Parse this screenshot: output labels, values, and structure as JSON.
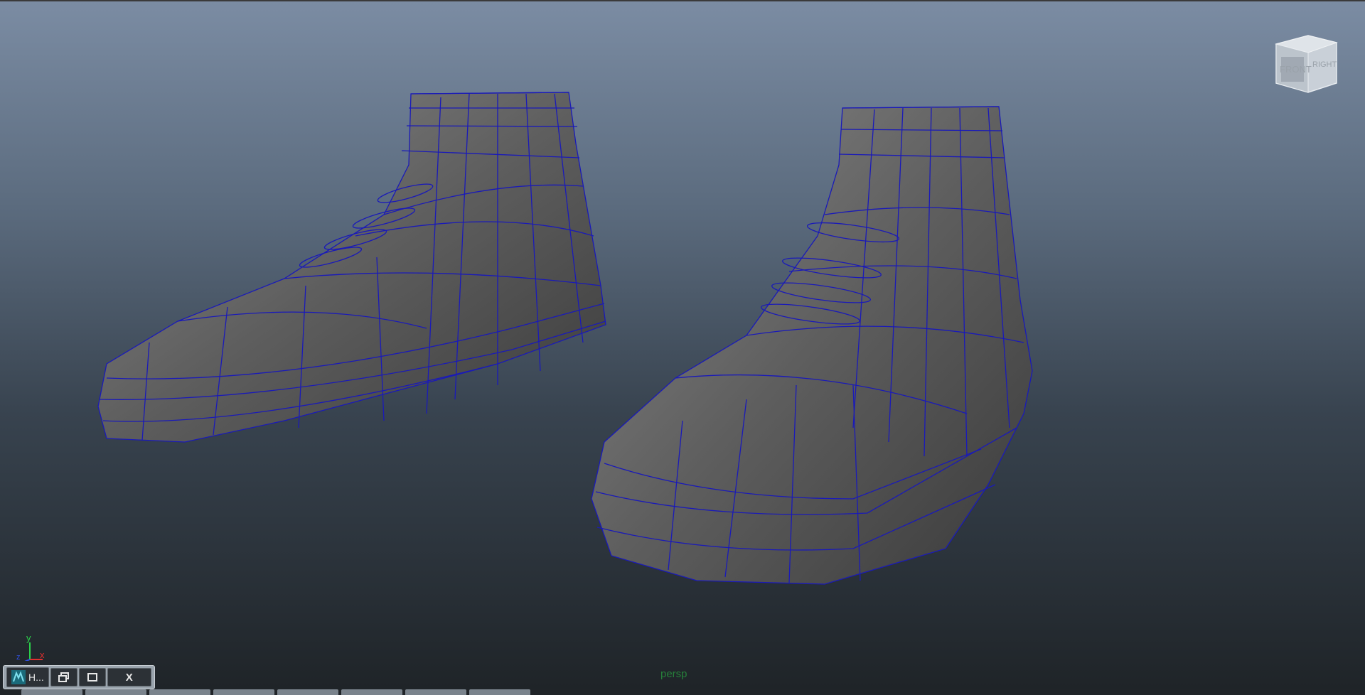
{
  "viewport": {
    "camera_label": "persp",
    "background_colors": [
      "#7b8ca3",
      "#38434f",
      "#1f2428"
    ],
    "wire_color": "#1a1ab8",
    "mesh_color": "#5a5a5a"
  },
  "viewcube": {
    "front_label": "FRONT",
    "right_label": "RIGHT",
    "icon": "view-cube-icon"
  },
  "axis_gizmo": {
    "y_label": "y",
    "x_label": "x",
    "z_label": "z"
  },
  "minimized_window": {
    "title": "H...",
    "app_icon": "maya-icon",
    "restore_icon": "restore-icon",
    "maximize_icon": "maximize-icon",
    "close_label": "X"
  },
  "taskbar": {
    "tabs": [
      "",
      "",
      "",
      "",
      "",
      "",
      "",
      ""
    ]
  }
}
